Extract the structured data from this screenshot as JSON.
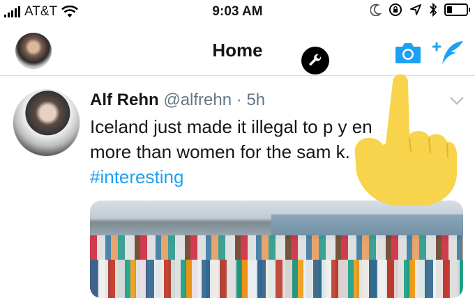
{
  "status_bar": {
    "carrier": "AT&T",
    "time": "9:03 AM",
    "icons": [
      "signal-icon",
      "wifi-icon",
      "moon-icon",
      "orientation-lock-icon",
      "location-arrow-icon",
      "bluetooth-icon",
      "battery-icon"
    ]
  },
  "nav": {
    "title": "Home",
    "icons": [
      "avatar",
      "wrench-icon",
      "camera-icon",
      "compose-tweet-icon"
    ],
    "accent": "#1da1f2"
  },
  "tweet": {
    "author_name": "Alf Rehn",
    "author_handle": "@alfrehn",
    "separator": "·",
    "time": "5h",
    "text_line1": "Iceland just made it illegal to p",
    "text_line1_tail": "y  en",
    "text_line2": "more than women for the sam",
    "text_line2_tail": "k.",
    "hashtag": "#interesting"
  },
  "overlay": {
    "icons": [
      "tap-hand-icon"
    ],
    "hand_color": "#f7d44c"
  }
}
